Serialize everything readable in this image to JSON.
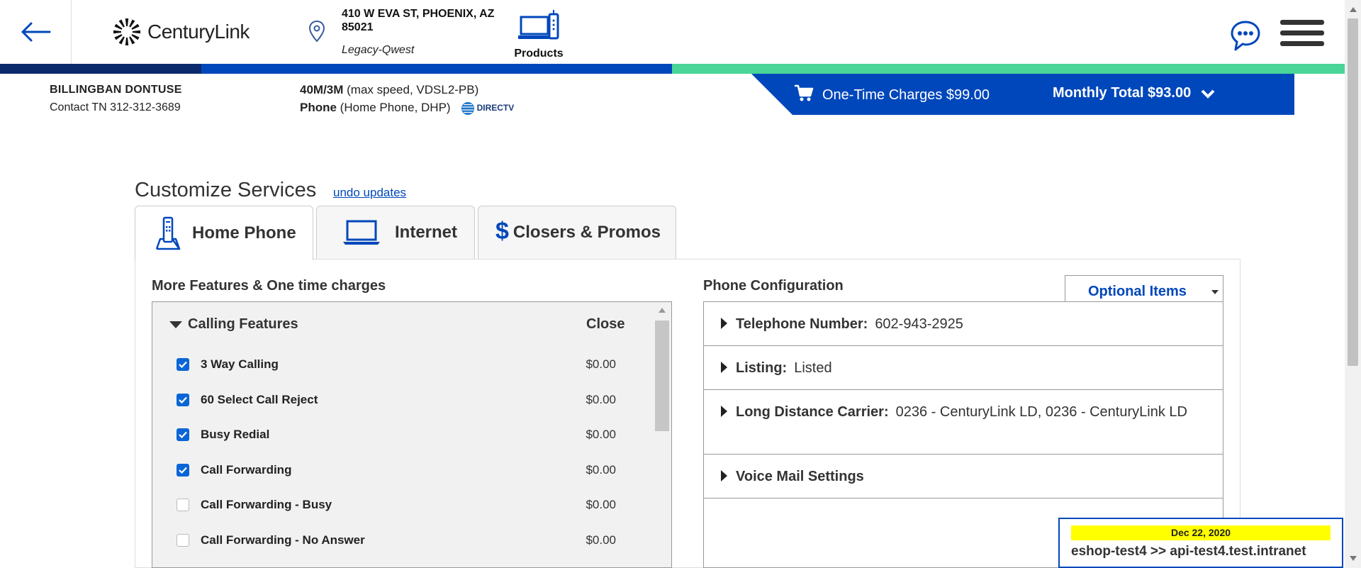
{
  "header": {
    "brand": "CenturyLink",
    "address_line": "410 W EVA ST, PHOENIX, AZ 85021",
    "address_sub": "Legacy-Qwest",
    "products_label": "Products"
  },
  "customer": {
    "name": "BILLINGBAN DONTUSE",
    "contact": "Contact TN 312-312-3689"
  },
  "services": {
    "internet_bold": "40M/3M",
    "internet_detail": " (max speed, VDSL2-PB)",
    "phone_bold": "Phone",
    "phone_detail": " (Home Phone, DHP)",
    "partner": "DIRECTV"
  },
  "totals": {
    "one_time": "One-Time Charges $99.00",
    "monthly": "Monthly Total $93.00"
  },
  "customize": {
    "title": "Customize Services",
    "undo": "undo updates",
    "tabs": [
      {
        "label": "Home Phone",
        "icon": "cordless-phone-icon"
      },
      {
        "label": "Internet",
        "icon": "laptop-icon"
      },
      {
        "label": "Closers & Promos",
        "icon": "dollar-icon"
      }
    ]
  },
  "features": {
    "section_title": "More Features & One time charges",
    "group_title": "Calling Features",
    "close_label": "Close",
    "items": [
      {
        "label": "3 Way Calling",
        "price": "$0.00",
        "checked": true
      },
      {
        "label": "60 Select Call Reject",
        "price": "$0.00",
        "checked": true
      },
      {
        "label": "Busy Redial",
        "price": "$0.00",
        "checked": true
      },
      {
        "label": "Call Forwarding",
        "price": "$0.00",
        "checked": true
      },
      {
        "label": "Call Forwarding - Busy",
        "price": "$0.00",
        "checked": false
      },
      {
        "label": "Call Forwarding - No Answer",
        "price": "$0.00",
        "checked": false
      }
    ]
  },
  "config": {
    "section_title": "Phone Configuration",
    "optional_items": "Optional Items",
    "rows": [
      {
        "label": "Telephone Number:",
        "value": "602-943-2925"
      },
      {
        "label": "Listing:",
        "value": "Listed"
      },
      {
        "label": "Long Distance Carrier:",
        "value": "0236 - CenturyLink LD, 0236 - CenturyLink LD"
      },
      {
        "label": "Voice Mail Settings",
        "value": ""
      }
    ]
  },
  "environment": {
    "date": "Dec 22, 2020",
    "host": "eshop-test4 >> api-test4.test.intranet"
  },
  "colors": {
    "brand_blue": "#0047bb",
    "navy": "#0b2a6b",
    "green": "#48d597",
    "checkbox": "#0a66d6"
  }
}
